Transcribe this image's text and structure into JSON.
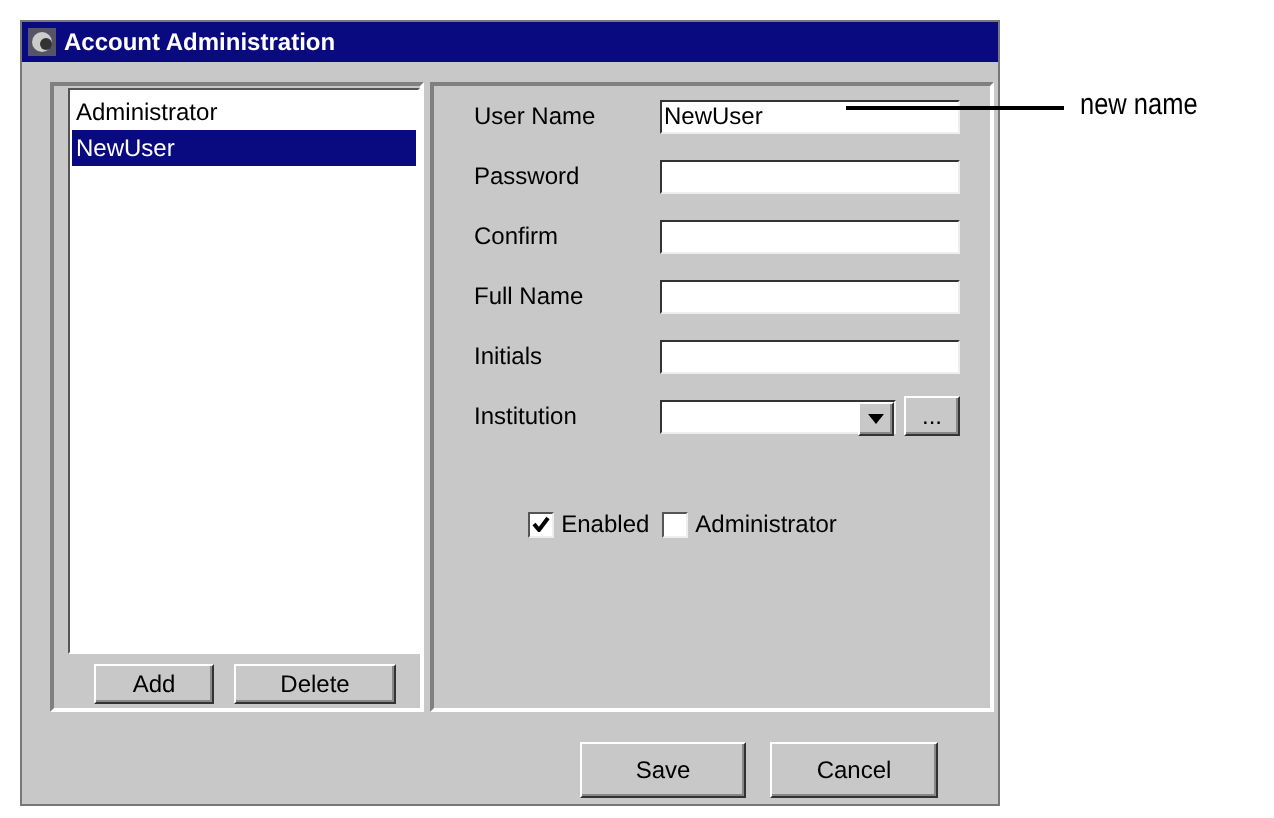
{
  "window": {
    "title": "Account Administration"
  },
  "users": [
    {
      "label": "Administrator",
      "selected": false
    },
    {
      "label": "NewUser",
      "selected": true
    }
  ],
  "list_buttons": [
    "Add",
    "Delete"
  ],
  "fields": [
    {
      "kind": "text",
      "label": "User Name",
      "value": "NewUser"
    },
    {
      "kind": "text",
      "label": "Password"
    },
    {
      "kind": "text",
      "label": "Confirm"
    },
    {
      "kind": "text",
      "label": "Full Name"
    },
    {
      "kind": "text",
      "label": "Initials"
    },
    {
      "kind": "combo",
      "label": "Institution",
      "button": "..."
    }
  ],
  "checkboxes": [
    {
      "label": "Enabled",
      "checked": true
    },
    {
      "label": "Administrator",
      "checked": false
    }
  ],
  "buttons": [
    "Save",
    "Cancel"
  ],
  "annotation": {
    "text": "new name"
  }
}
